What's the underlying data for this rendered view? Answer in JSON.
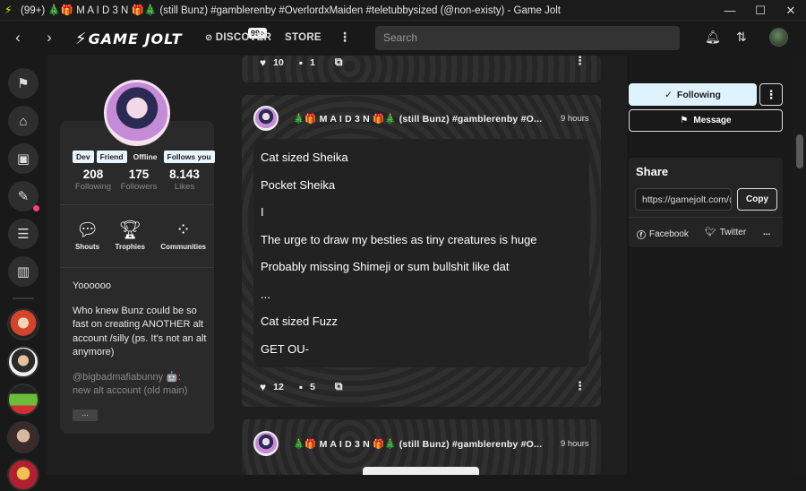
{
  "window": {
    "title": "(99+) 🎄🎁 M A I D 3 N 🎁🎄 (still Bunz) #gamblerenby #OverlordxMaiden #teletubbysized (@non-existy) - Game Jolt",
    "minimize": "—",
    "maximize": "☐",
    "close": "✕"
  },
  "navbar": {
    "back_icon": "‹",
    "forward_icon": "›",
    "logo_text": "GAME JOLT",
    "notif_count": "99+",
    "discover": "DISCOVER",
    "store": "STORE",
    "more": "⋮",
    "search_placeholder": "Search"
  },
  "profile": {
    "tags": [
      "Dev",
      "Friend",
      "Offline",
      "Follows you"
    ],
    "stats": [
      {
        "num": "208",
        "label": "Following"
      },
      {
        "num": "175",
        "label": "Followers"
      },
      {
        "num": "8.143",
        "label": "Likes"
      }
    ],
    "actions": [
      "Shouts",
      "Trophies",
      "Communities"
    ],
    "bio": {
      "line1": "Yoooooo",
      "line2": "Who knew Bunz could be so fast on creating ANOTHER alt account /silly (ps. It's not an alt anymore)",
      "line3": "@bigbadmafiabunny 🤖:",
      "line4": "new alt account (old main)"
    },
    "more_label": "..."
  },
  "posts": [
    {
      "likes": "10",
      "comments": "1"
    },
    {
      "author": "🎄🎁 M A I D 3 N 🎁🎄 (still Bunz) #gamblerenby #O...",
      "time": "9 hours",
      "lines": [
        "Cat sized Sheika",
        "Pocket Sheika",
        "I",
        "The urge to draw my besties as tiny creatures is huge",
        "Probably missing Shimeji or sum bullshit like dat",
        "...",
        "Cat sized Fuzz",
        "GET OU-"
      ],
      "likes": "12",
      "comments": "5"
    },
    {
      "author": "🎄🎁 M A I D 3 N 🎁🎄 (still Bunz) #gamblerenby #O...",
      "time": "9 hours"
    }
  ],
  "right": {
    "following": "Following",
    "message": "Message",
    "share_title": "Share",
    "share_url": "https://gamejolt.com/@non-existy",
    "copy": "Copy",
    "facebook": "Facebook",
    "twitter": "Twitter",
    "more": "..."
  },
  "colors": {
    "accent_light": "#dff3ff",
    "notif_dot": "#ff3d7f",
    "logo_accent": "#ccff00"
  }
}
